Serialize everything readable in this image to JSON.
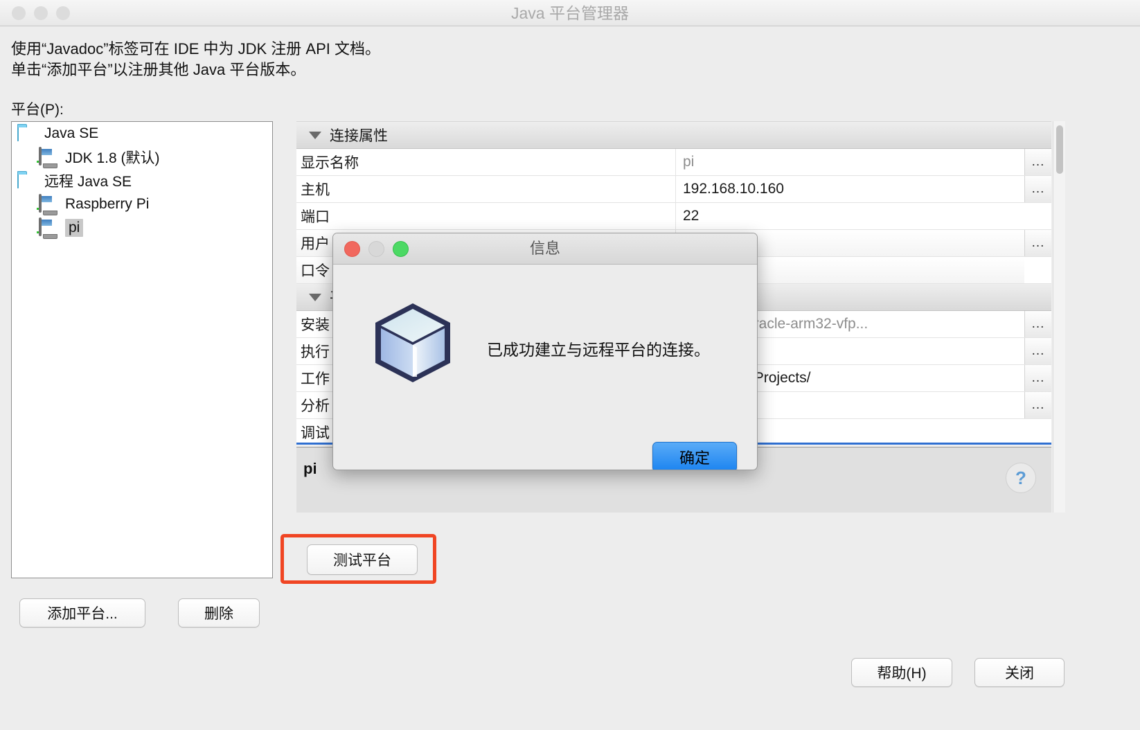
{
  "window": {
    "title": "Java 平台管理器",
    "traffic_lights": [
      "close",
      "minimize",
      "zoom"
    ]
  },
  "intro": {
    "line1": "使用“Javadoc”标签可在 IDE 中为 JDK 注册 API 文档。",
    "line2": "单击“添加平台”以注册其他 Java 平台版本。"
  },
  "platform_label": "平台(P):",
  "tree": {
    "items": [
      {
        "label": "Java SE",
        "icon": "folder-icon",
        "indent": 0
      },
      {
        "label": "JDK 1.8 (默认)",
        "icon": "platform-icon",
        "indent": 1
      },
      {
        "label": "远程 Java SE",
        "icon": "folder-icon",
        "indent": 0
      },
      {
        "label": "Raspberry Pi",
        "icon": "platform-icon",
        "indent": 1
      },
      {
        "label": "pi",
        "icon": "platform-icon",
        "indent": 1,
        "selected": true
      }
    ]
  },
  "properties": {
    "sections": [
      {
        "title": "连接属性",
        "expanded": true,
        "rows": [
          {
            "name": "显示名称",
            "value": "pi",
            "muted": true,
            "has_browse": true
          },
          {
            "name": "主机",
            "value": "192.168.10.160",
            "muted": false,
            "has_browse": true
          },
          {
            "name": "端口",
            "value": "22",
            "muted": false,
            "has_browse": false
          },
          {
            "name": "用户",
            "value": "",
            "muted": false,
            "has_browse": true
          },
          {
            "name": "口令",
            "value": "",
            "muted": false,
            "has_browse": false
          }
        ]
      },
      {
        "title": "平",
        "expanded": true,
        "rows": [
          {
            "name": "安装",
            "value": "jvm/jdk-8-oracle-arm32-vfp...",
            "muted": true,
            "has_browse": true
          },
          {
            "name": "执行",
            "value": "",
            "muted": false,
            "has_browse": true
          },
          {
            "name": "工作",
            "value": "i/NetBeansProjects/",
            "muted": false,
            "has_browse": true
          },
          {
            "name": "分析",
            "value": "",
            "muted": false,
            "has_browse": true
          },
          {
            "name": "调试",
            "value": "",
            "muted": false,
            "has_browse": false
          }
        ]
      }
    ]
  },
  "description": {
    "title": "pi",
    "help_glyph": "?"
  },
  "buttons": {
    "test_platform": "测试平台",
    "add_platform": "添加平台...",
    "remove": "删除",
    "help": "帮助(H)",
    "close": "关闭"
  },
  "annotation": {
    "color": "#f04523",
    "target": "测试平台"
  },
  "dialog": {
    "title": "信息",
    "message": "已成功建立与远程平台的连接。",
    "ok_label": "确定",
    "icon": "cube-icon",
    "traffic_lights": [
      "close",
      "minimize",
      "zoom"
    ]
  }
}
